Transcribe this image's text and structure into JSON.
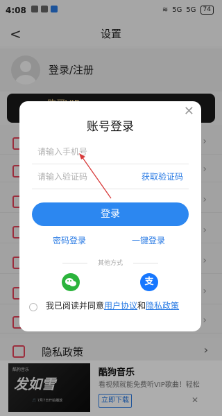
{
  "status_bar": {
    "time": "4:08",
    "battery": "74",
    "network_1": "5G",
    "network_2": "5G"
  },
  "header": {
    "title": "设置"
  },
  "user": {
    "login_label": "登录/注册"
  },
  "vip": {
    "label": "购买VIP"
  },
  "settings": {
    "privacy_label": "隐私政策"
  },
  "modal": {
    "title": "账号登录",
    "phone_placeholder": "请输入手机号",
    "code_placeholder": "请输入验证码",
    "get_code_label": "获取验证码",
    "login_button": "登录",
    "password_login": "密码登录",
    "one_click_login": "一键登录",
    "other_methods": "其他方式",
    "alipay_glyph": "支",
    "agreement_prefix": "我已阅读并同意",
    "user_agreement": "用户协议",
    "and": "和",
    "privacy_policy": "隐私政策"
  },
  "ad": {
    "title": "酷狗音乐",
    "description": "看视频就能免费听VIP歌曲！轻松",
    "button": "立即下载",
    "poster_text": "发如雪",
    "poster_top": "酷狗音乐",
    "poster_bottom": "🎵 7月7日开始播放"
  },
  "colors": {
    "accent": "#2c87f0",
    "link": "#2a7be4",
    "wechat": "#2bb43c",
    "alipay": "#1677ff",
    "icon_red": "#e5455a"
  }
}
